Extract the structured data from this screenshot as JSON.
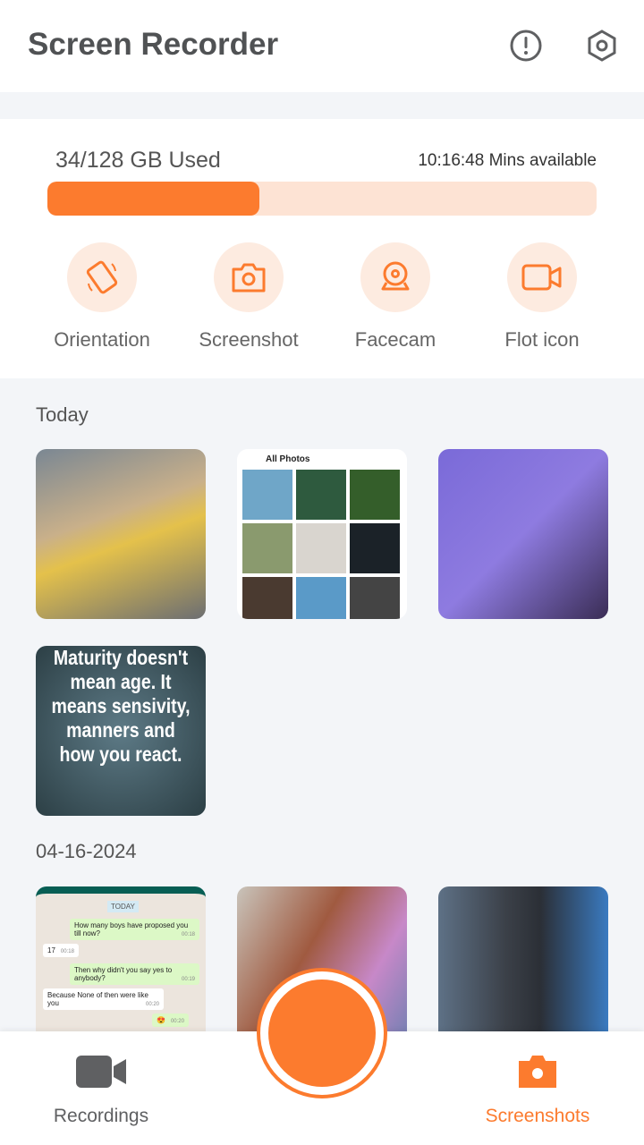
{
  "header": {
    "title": "Screen Recorder",
    "icons": [
      "info-icon",
      "settings-icon"
    ]
  },
  "storage": {
    "used_label": "34/128 GB Used",
    "available_label": "10:16:48 Mins available",
    "progress_percent": 38.6,
    "accent": "#fc7b2e",
    "track": "#fde3d4"
  },
  "actions": [
    {
      "label": "Orientation",
      "icon": "orientation-icon"
    },
    {
      "label": "Screenshot",
      "icon": "camera-icon"
    },
    {
      "label": "Facecam",
      "icon": "webcam-icon"
    },
    {
      "label": "Flot icon",
      "icon": "video-icon"
    }
  ],
  "sections": [
    {
      "title": "Today",
      "thumbs": [
        {
          "kind": "photo"
        },
        {
          "kind": "gallery",
          "header": "All Photos"
        },
        {
          "kind": "photo"
        },
        {
          "kind": "quote",
          "text": "Maturity doesn't mean age. It means sensivity, manners and how you react."
        }
      ]
    },
    {
      "title": "04-16-2024",
      "thumbs": [
        {
          "kind": "chat",
          "day": "TODAY",
          "messages": [
            {
              "text": "How many boys have proposed you till now?",
              "time": "00:18"
            },
            {
              "text": "17",
              "time": "00:18"
            },
            {
              "text": "Then why didn't you say yes to anybody?",
              "time": "00:19"
            },
            {
              "text": "Because None of then were like you",
              "time": "00:20"
            },
            {
              "text": "😍",
              "time": "00:20"
            }
          ]
        },
        {
          "kind": "photo"
        },
        {
          "kind": "photo"
        }
      ]
    }
  ],
  "nav": {
    "recordings": "Recordings",
    "screenshots": "Screenshots",
    "active": "Screenshots",
    "inactive_color": "#5f6062"
  }
}
